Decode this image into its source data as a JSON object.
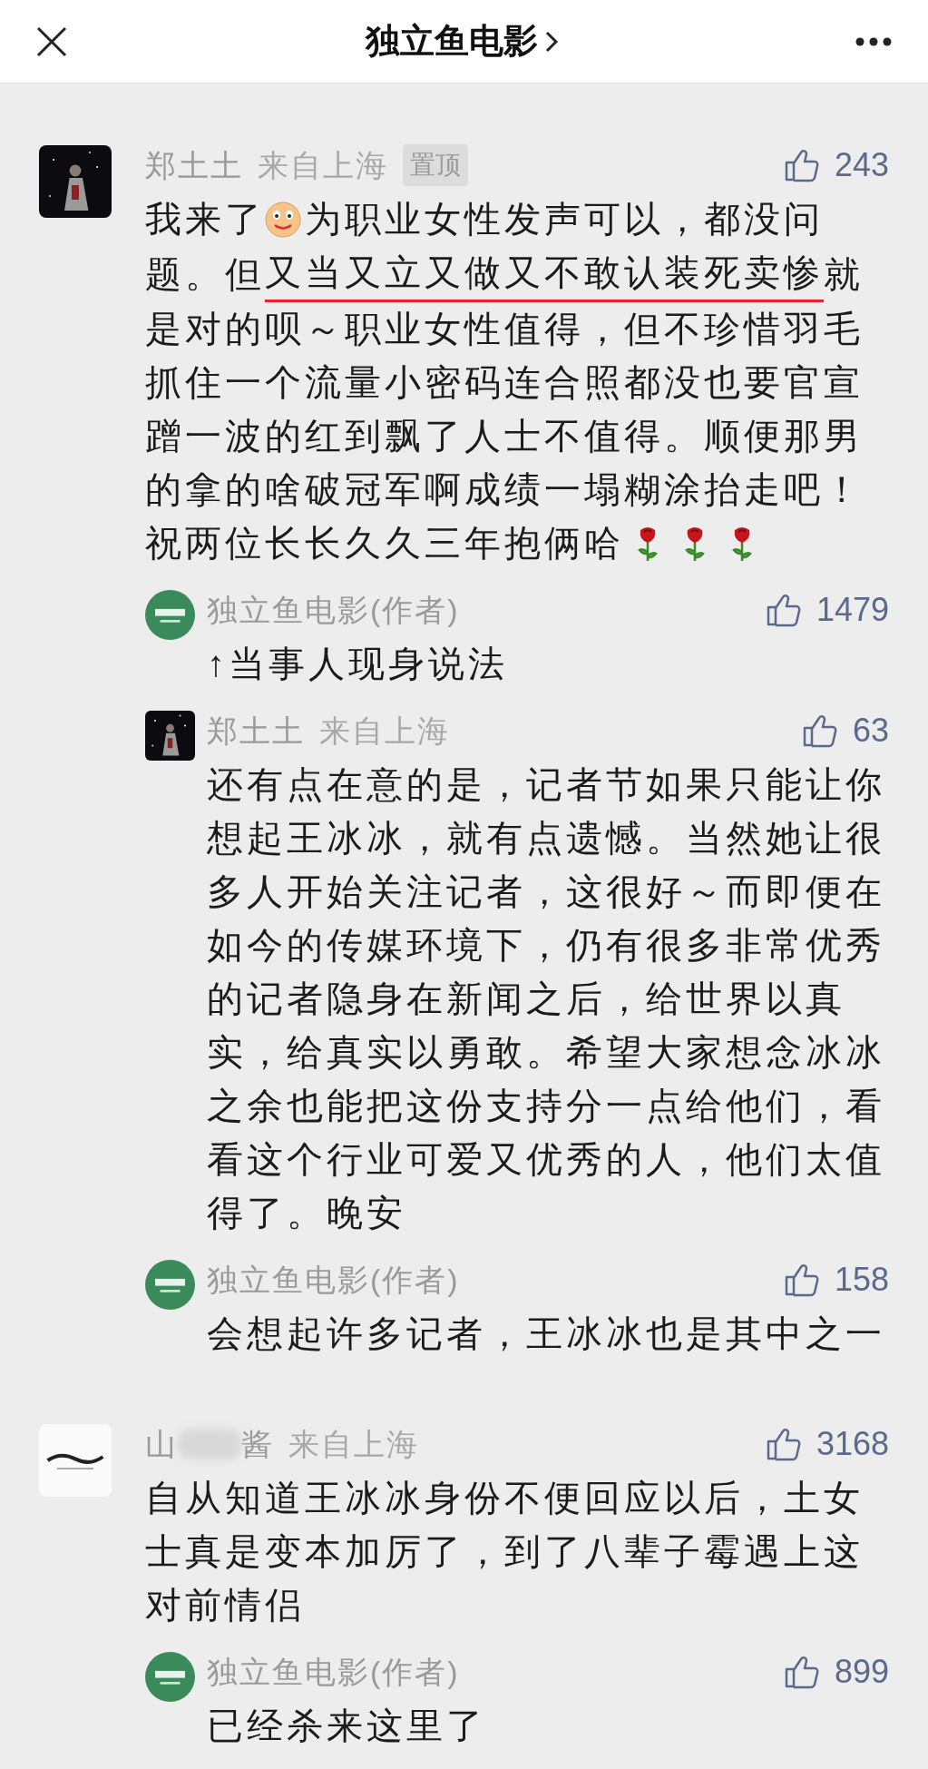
{
  "header": {
    "title": "独立鱼电影"
  },
  "comments": [
    {
      "author": [
        "郑土土"
      ],
      "redacted": false,
      "location": "来自上海",
      "pinned": true,
      "pin_label": "置顶",
      "likes": "243",
      "avatar": {
        "kind": "dark"
      },
      "body": [
        [
          {
            "kind": "text",
            "text": "我来了"
          },
          {
            "kind": "emoji"
          },
          {
            "kind": "text",
            "text": "为职业女性发声可以，都没问"
          }
        ],
        [
          {
            "kind": "text",
            "text": "题。但"
          },
          {
            "kind": "underline",
            "text": "又当又立又做又不敢认装死卖惨"
          },
          {
            "kind": "text",
            "text": "就"
          }
        ],
        [
          {
            "kind": "text",
            "text": "是对的呗～职业女性值得，但不珍惜羽毛"
          }
        ],
        [
          {
            "kind": "text",
            "text": "抓住一个流量小密码连合照都没也要官宣"
          }
        ],
        [
          {
            "kind": "text",
            "text": "蹭一波的红到飘了人士不值得。顺便那男"
          }
        ],
        [
          {
            "kind": "text",
            "text": "的拿的啥破冠军啊成绩一塌糊涂抬走吧！"
          }
        ],
        [
          {
            "kind": "text",
            "text": "祝两位长长久久三年抱俩哈"
          },
          {
            "kind": "rose"
          },
          {
            "kind": "rose"
          },
          {
            "kind": "rose"
          }
        ]
      ],
      "replies": [
        {
          "author": "独立鱼电影(作者)",
          "likes": "1479",
          "avatar": {
            "kind": "green"
          },
          "text": "↑当事人现身说法"
        },
        {
          "author": "郑土土",
          "location": "来自上海",
          "likes": "63",
          "avatar": {
            "kind": "dark"
          },
          "text": "还有点在意的是，记者节如果只能让你想起王冰冰，就有点遗憾。当然她让很多人开始关注记者，这很好～而即便在如今的传媒环境下，仍有很多非常优秀的记者隐身在新闻之后，给世界以真实，给真实以勇敢。希望大家想念冰冰之余也能把这份支持分一点给他们，看看这个行业可爱又优秀的人，他们太值得了。晚安"
        },
        {
          "author": "独立鱼电影(作者)",
          "likes": "158",
          "avatar": {
            "kind": "green"
          },
          "text": "会想起许多记者，王冰冰也是其中之一"
        }
      ]
    },
    {
      "author": [
        "山",
        "酱"
      ],
      "redacted": true,
      "location": "来自上海",
      "pinned": false,
      "likes": "3168",
      "avatar": {
        "kind": "white"
      },
      "body": [
        [
          {
            "kind": "text",
            "text": "自从知道王冰冰身份不便回应以后，土女士真是变本加厉了，到了八辈子霉遇上这对前情侣"
          }
        ]
      ],
      "replies": [
        {
          "author": "独立鱼电影(作者)",
          "likes": "899",
          "avatar": {
            "kind": "green"
          },
          "text": "已经杀来这里了"
        }
      ]
    }
  ]
}
